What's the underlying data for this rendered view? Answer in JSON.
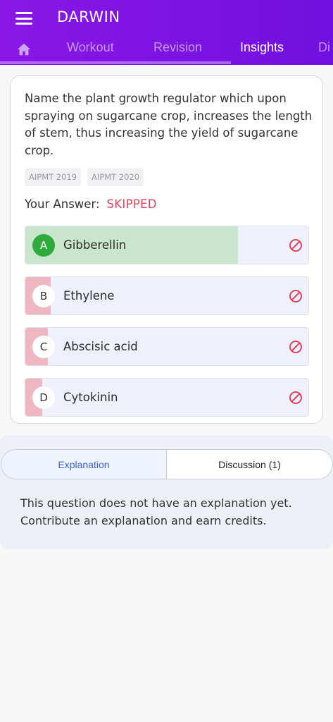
{
  "app": {
    "title": "DARWIN"
  },
  "nav": {
    "tabs": [
      {
        "label": "Workout"
      },
      {
        "label": "Revision"
      },
      {
        "label": "Insights"
      },
      {
        "label": "Di"
      }
    ],
    "active_tab": "Insights",
    "brand_color": "#7a12e4"
  },
  "question": {
    "text": "Name the plant growth regulator which upon spraying on sugarcane crop, increases the length of stem, thus increasing the yield of sugarcane crop.",
    "tags": [
      "AIPMT 2019",
      "AIPMT 2020"
    ],
    "answer_label": "Your Answer:",
    "answer_value": "SKIPPED",
    "options": [
      {
        "letter": "A",
        "text": "Gibberellin",
        "status": "correct",
        "response_share": 0.75,
        "icon": "skipped-icon"
      },
      {
        "letter": "B",
        "text": "Ethylene",
        "status": "other",
        "response_share": 0.09,
        "icon": "skipped-icon"
      },
      {
        "letter": "C",
        "text": "Abscisic acid",
        "status": "other",
        "response_share": 0.08,
        "icon": "skipped-icon"
      },
      {
        "letter": "D",
        "text": "Cytokinin",
        "status": "other",
        "response_share": 0.06,
        "icon": "skipped-icon"
      }
    ]
  },
  "explanation_tabs": {
    "explanation_label": "Explanation",
    "discussion_label": "Discussion (1)",
    "active": "Explanation"
  },
  "explanation": {
    "text": "This question does not have an explanation yet. Contribute an explanation and earn credits."
  },
  "colors": {
    "correct": "#2faa3e",
    "skipped": "#e0455a",
    "accent_blue": "#3a63d6"
  }
}
